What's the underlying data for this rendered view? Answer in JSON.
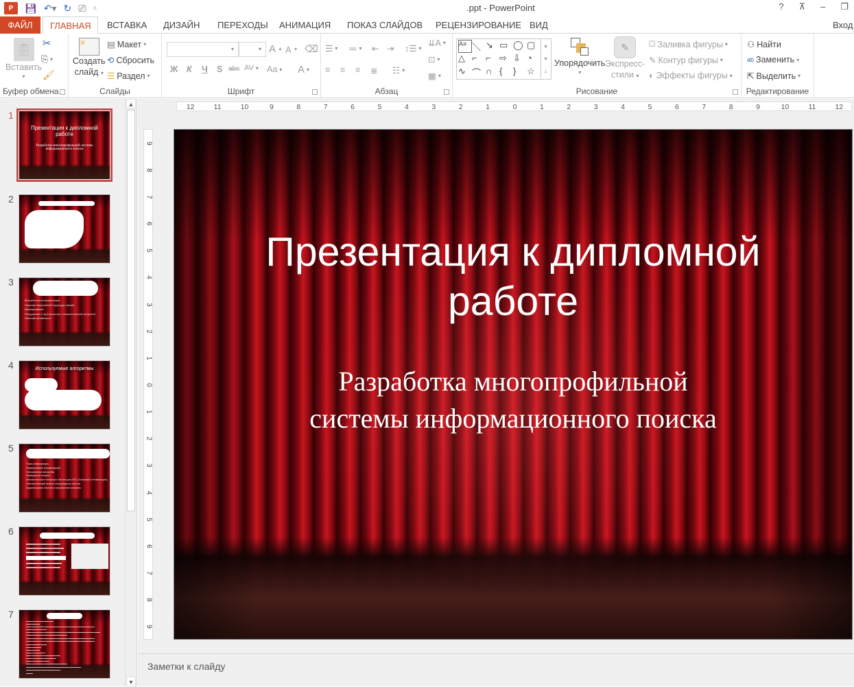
{
  "window": {
    "title": ".ppt - PowerPoint",
    "app_icon": "P",
    "controls": {
      "help": "?",
      "ribbon_options": "⊼",
      "minimize": "–",
      "restore": "❐"
    }
  },
  "quick_access": {
    "icons": [
      "save-icon",
      "undo-icon",
      "redo-icon",
      "start-from-beginning-icon",
      "customize-qat-icon"
    ]
  },
  "tabs": [
    {
      "label": "ФАЙЛ",
      "active": false
    },
    {
      "label": "ГЛАВНАЯ",
      "active": true
    },
    {
      "label": "ВСТАВКА",
      "active": false
    },
    {
      "label": "ДИЗАЙН",
      "active": false
    },
    {
      "label": "ПЕРЕХОДЫ",
      "active": false
    },
    {
      "label": "АНИМАЦИЯ",
      "active": false
    },
    {
      "label": "ПОКАЗ СЛАЙДОВ",
      "active": false
    },
    {
      "label": "РЕЦЕНЗИРОВАНИЕ",
      "active": false
    },
    {
      "label": "ВИД",
      "active": false
    }
  ],
  "signin": "Вход",
  "ribbon": {
    "clipboard": {
      "label": "Буфер обмена",
      "paste": "Вставить"
    },
    "slides": {
      "label": "Слайды",
      "new_slide_1": "Создать",
      "new_slide_2": "слайд",
      "layout": "Макет",
      "reset": "Сбросить",
      "section": "Раздел"
    },
    "font": {
      "label": "Шрифт",
      "font_name": "",
      "font_size": "",
      "bold": "Ж",
      "italic": "К",
      "underline": "Ч",
      "shadow": "S",
      "strike": "abc",
      "spacing": "AV",
      "case": "Aa",
      "color": "A",
      "grow": "A",
      "shrink": "A"
    },
    "paragraph": {
      "label": "Абзац"
    },
    "drawing": {
      "label": "Рисование",
      "arrange": "Упорядочить",
      "quick_styles_1": "Экспресс-",
      "quick_styles_2": "стили",
      "fill": "Заливка фигуры",
      "outline": "Контур фигуры",
      "effects": "Эффекты фигуры",
      "shapes": [
        "A≡",
        "＼",
        "↘",
        "▭",
        "◯",
        "▢",
        "△",
        "⌐",
        "⌐",
        "⇨",
        "⇩",
        "◔",
        "∿",
        "⌒",
        "∩",
        "{",
        "}",
        "☆"
      ]
    },
    "editing": {
      "label": "Редактирование",
      "find": "Найти",
      "replace": "Заменить",
      "select": "Выделить"
    }
  },
  "slides_panel": {
    "selected": 1,
    "thumbnails": [
      {
        "number": "1",
        "title": "Презентация к дипломной работе",
        "subtitle": "Разработка многопрофильной системы информационного поиска"
      },
      {
        "number": "2",
        "title": "",
        "subtitle": ""
      },
      {
        "number": "3",
        "title": "",
        "items": [
          "Внутренняя интерпретация.",
          "Наличие внутренней структуры связей.",
          "Шкалирование.",
          "Погружение в пространство с семантической метрикой.",
          "Наличие активности."
        ]
      },
      {
        "number": "4",
        "title": "Используемые алгоритмы",
        "items": []
      },
      {
        "number": "5",
        "title": "",
        "items": [
          "Поиск информации.",
          "Формирование рекомендаций.",
          "Установление авторства.",
          "Проверка на плагиат.",
          "Автоматическая генерация текстов для SEO (поисковой оптимизации).",
          "Лингвистический анализ литературных текстов.",
          "Корректировка текстов и исправление опечаток."
        ]
      },
      {
        "number": "6",
        "title": "",
        "items": []
      },
      {
        "number": "7",
        "title": "",
        "items": []
      }
    ]
  },
  "ruler": {
    "horizontal": [
      "12",
      "11",
      "10",
      "9",
      "8",
      "7",
      "6",
      "5",
      "4",
      "3",
      "2",
      "1",
      "0",
      "1",
      "2",
      "3",
      "4",
      "5",
      "6",
      "7",
      "8",
      "9",
      "10",
      "11",
      "12"
    ],
    "vertical": [
      "9",
      "8",
      "7",
      "6",
      "5",
      "4",
      "3",
      "2",
      "1",
      "0",
      "1",
      "2",
      "3",
      "4",
      "5",
      "6",
      "7",
      "8",
      "9"
    ]
  },
  "slide": {
    "title": "Презентация к дипломной работе",
    "subtitle_line1": "Разработка многопрофильной",
    "subtitle_line2": "системы информационного поиска"
  },
  "notes": {
    "placeholder": "Заметки к слайду"
  },
  "colors": {
    "accent": "#d24726",
    "selection": "#c0504d"
  }
}
